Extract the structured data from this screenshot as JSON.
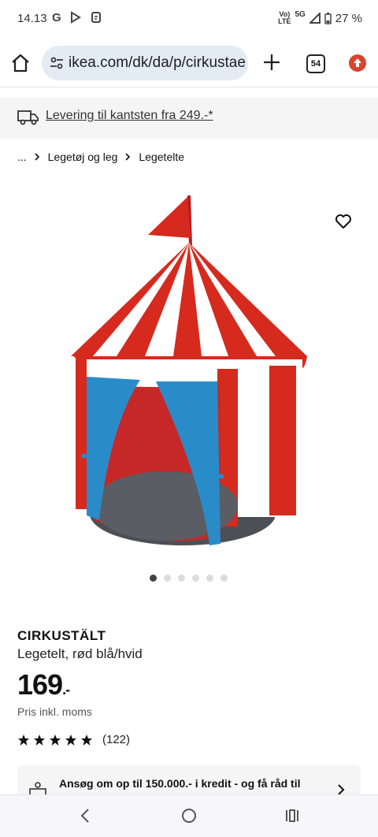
{
  "status": {
    "time": "14.13",
    "icons": [
      "google-icon",
      "play-store-icon",
      "messages-icon"
    ],
    "network_top": "Vo)",
    "network_bottom": "LTE",
    "network_5g": "5G",
    "battery": "27 %"
  },
  "browser": {
    "url": "ikea.com/dk/da/p/cirkustae",
    "tab_count": "54",
    "update_color": "#d9442e"
  },
  "delivery": {
    "label": "Levering til kantsten fra 249.-*"
  },
  "breadcrumb": {
    "ellipsis": "...",
    "items": [
      "Legetøj og leg",
      "Legetelte"
    ]
  },
  "gallery": {
    "dot_count": 6,
    "active_index": 0
  },
  "product": {
    "name": "CIRKUSTÄLT",
    "description": "Legetelt, rød blå/hvid",
    "price": "169",
    "price_suffix": ".-",
    "price_note": "Pris inkl. moms",
    "rating_stars": 5,
    "rating_count": "(122)"
  },
  "credit": {
    "text": "Ansøg om op til 150.000.- i kredit - og få råd til"
  },
  "colors": {
    "accent_red": "#d32f2f",
    "tent_blue": "#2a8bc9"
  }
}
